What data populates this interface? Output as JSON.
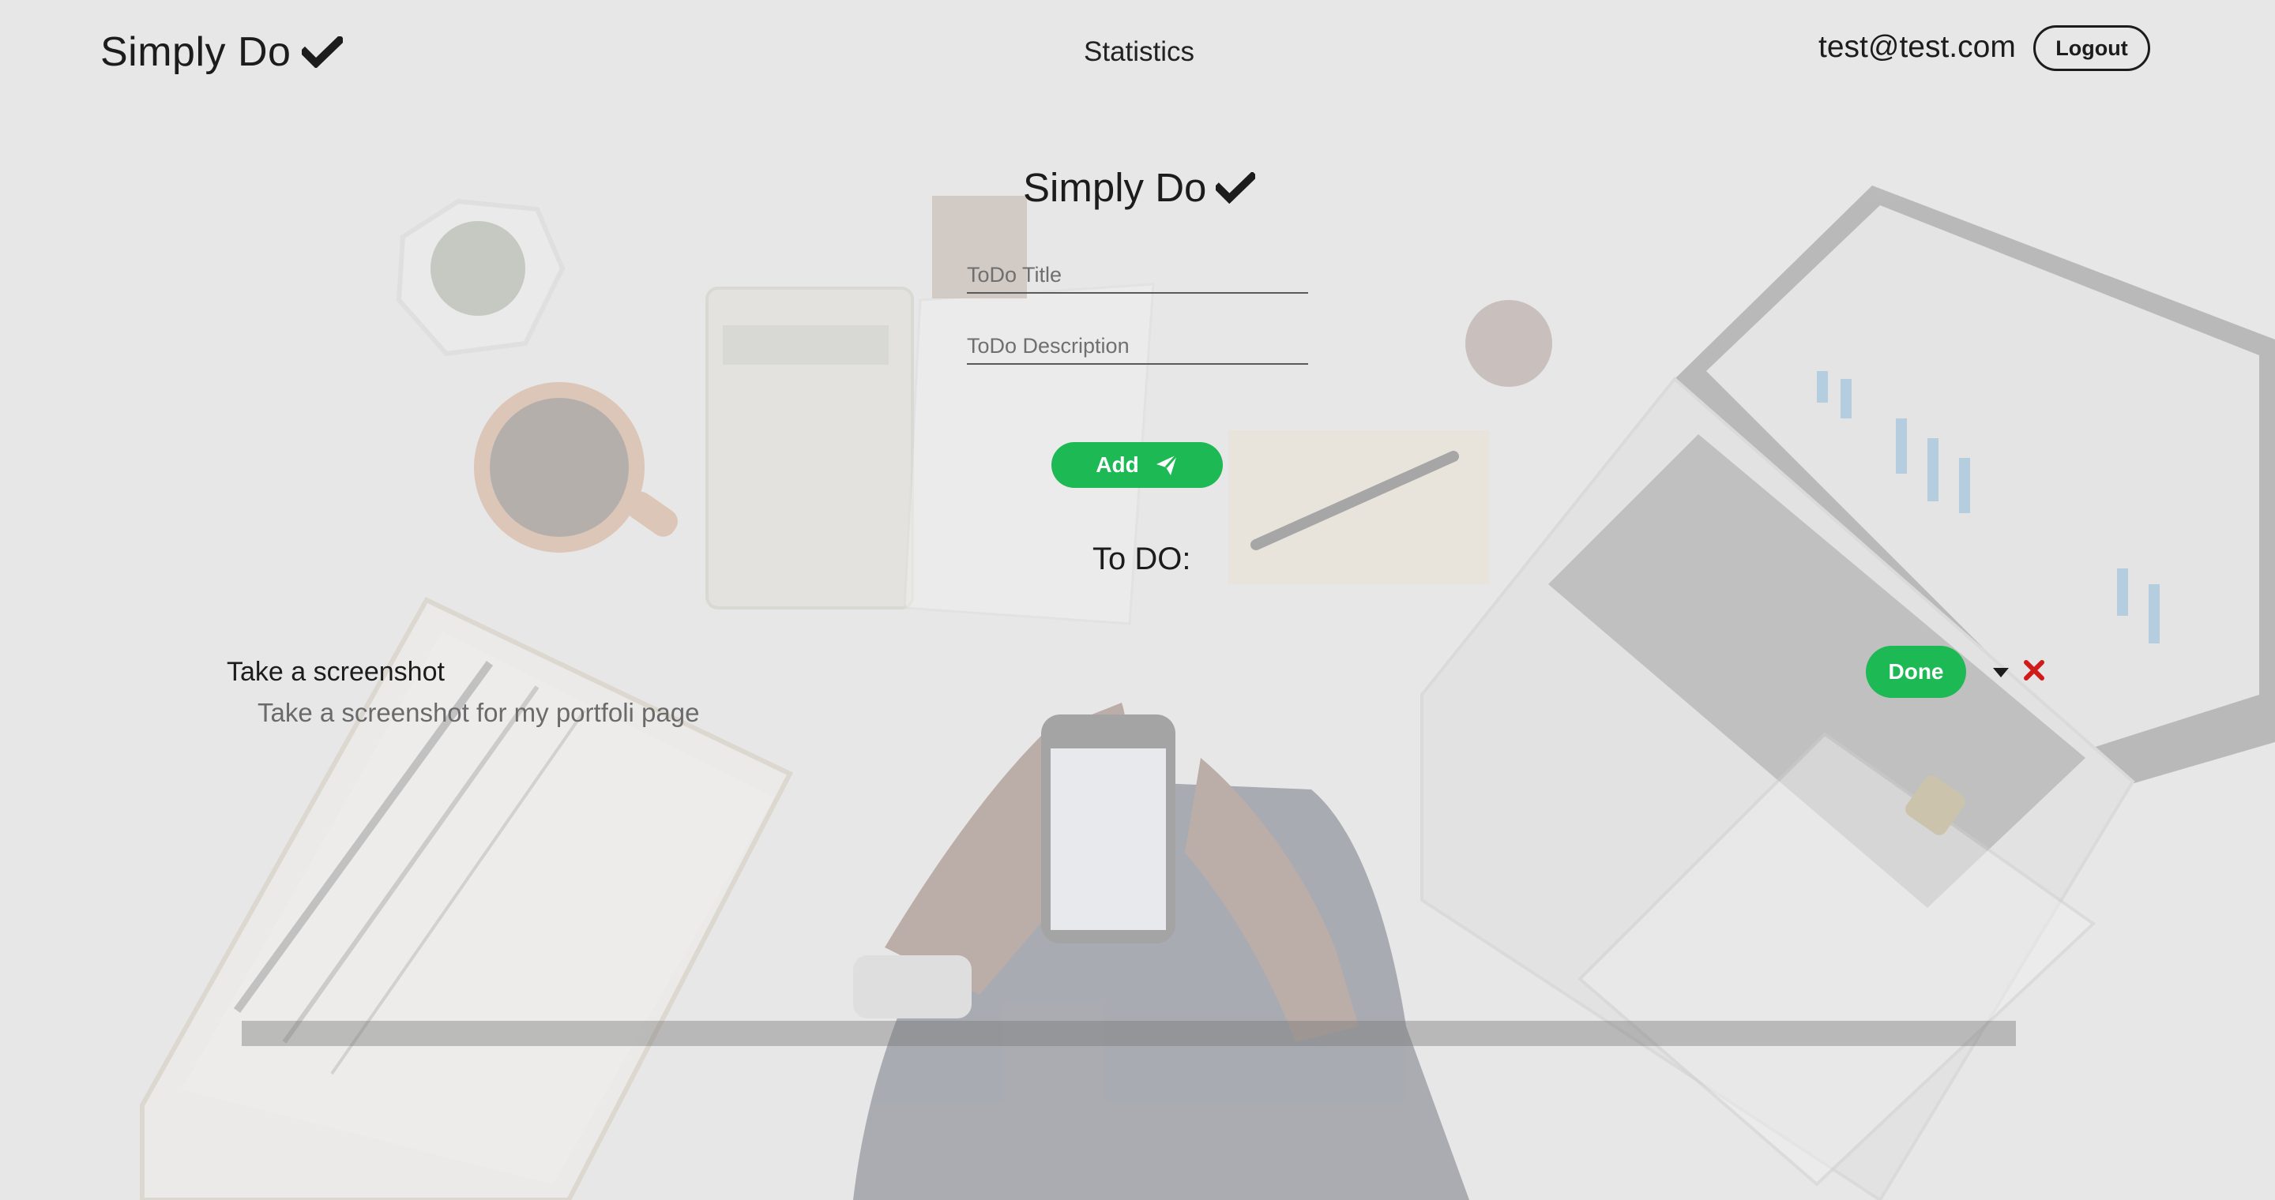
{
  "header": {
    "brand": "Simply Do",
    "nav_statistics": "Statistics",
    "user_email": "test@test.com",
    "logout_label": "Logout",
    "brand_icon": "check-icon"
  },
  "form": {
    "title": "Simply Do",
    "title_placeholder": "ToDo Title",
    "description_placeholder": "ToDo Description",
    "add_label": "Add",
    "add_icon": "paper-plane-icon"
  },
  "todo_list": {
    "heading": "To DO:",
    "items": [
      {
        "title": "Take a screenshot",
        "description": "Take a screenshot for my portfoli page",
        "done_label": "Done"
      }
    ]
  },
  "colors": {
    "accent_green": "#1db954",
    "delete_red": "#d11a1a",
    "text_dark": "#1c1c1c"
  }
}
